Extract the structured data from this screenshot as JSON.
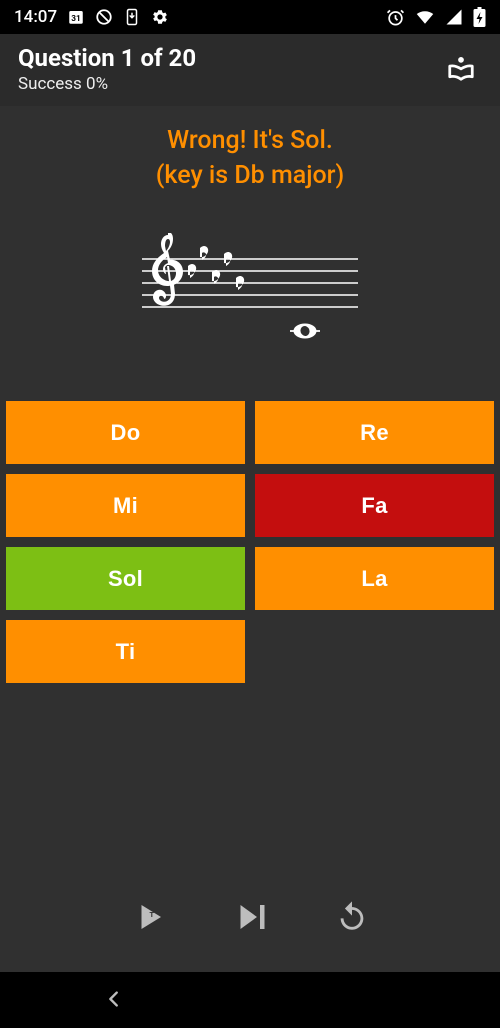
{
  "status_bar": {
    "time": "14:07",
    "icons_left": [
      "calendar-31-icon",
      "do-not-disturb-icon",
      "system-update-icon",
      "settings-icon"
    ],
    "icons_right": [
      "alarm-icon",
      "wifi-icon",
      "cell-signal-icon",
      "battery-charging-icon"
    ]
  },
  "header": {
    "title": "Question 1 of 20",
    "subtitle": "Success 0%",
    "action_icon": "library-reader-icon"
  },
  "feedback": {
    "line1": "Wrong! It's Sol.",
    "line2": "(key is Db major)"
  },
  "staff": {
    "clef": "treble",
    "key_signature": "Db major",
    "flats_count": 5,
    "note_displayed": "Sol (whole note below staff)"
  },
  "answers": [
    {
      "label": "Do",
      "state": "default"
    },
    {
      "label": "Re",
      "state": "default"
    },
    {
      "label": "Mi",
      "state": "default"
    },
    {
      "label": "Fa",
      "state": "wrong"
    },
    {
      "label": "Sol",
      "state": "correct"
    },
    {
      "label": "La",
      "state": "default"
    },
    {
      "label": "Ti",
      "state": "default"
    }
  ],
  "controls": {
    "play_icon": "play-icon",
    "next_icon": "skip-next-icon",
    "replay_icon": "replay-icon"
  },
  "colors": {
    "accent": "#ff8f00",
    "wrong": "#c40e0e",
    "correct": "#7dbf14",
    "bg_main": "#303030",
    "bg_appbar": "#2b2b2b"
  }
}
